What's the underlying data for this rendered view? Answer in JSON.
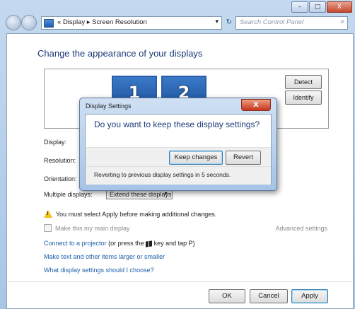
{
  "window": {
    "minimize": "–",
    "maximize": "□",
    "close": "X"
  },
  "address": {
    "prefix": "«",
    "crumb1": "Display",
    "sep": "▸",
    "crumb2": "Screen Resolution",
    "dropdown": "▾",
    "refresh": "↻",
    "search_placeholder": "Search Control Panel",
    "search_icon": "⌕"
  },
  "main": {
    "heading": "Change the appearance of your displays",
    "monitors": [
      "1",
      "2"
    ],
    "detect": "Detect",
    "identify": "Identify",
    "display_label": "Display:",
    "resolution_label": "Resolution:",
    "orientation_label": "Orientation:",
    "multiple_label": "Multiple displays:",
    "multiple_value": "Extend these displays",
    "warning": "You must select Apply before making additional changes.",
    "main_display": "Make this my main display",
    "advanced": "Advanced settings",
    "link_projector": "Connect to a projector",
    "projector_tail_a": "(or press the",
    "projector_tail_b": "key and tap P)",
    "link_text_size": "Make text and other items larger or smaller",
    "link_help": "What display settings should I choose?"
  },
  "buttons": {
    "ok": "OK",
    "cancel": "Cancel",
    "apply": "Apply"
  },
  "dialog": {
    "title": "Display Settings",
    "close": "X",
    "question": "Do you want to keep these display settings?",
    "keep": "Keep changes",
    "revert": "Revert",
    "note": "Reverting to previous display settings in 5 seconds."
  },
  "colors": {
    "heading": "#1c3a78",
    "link": "#1d5fa8",
    "monitor": "#2a5da6"
  }
}
